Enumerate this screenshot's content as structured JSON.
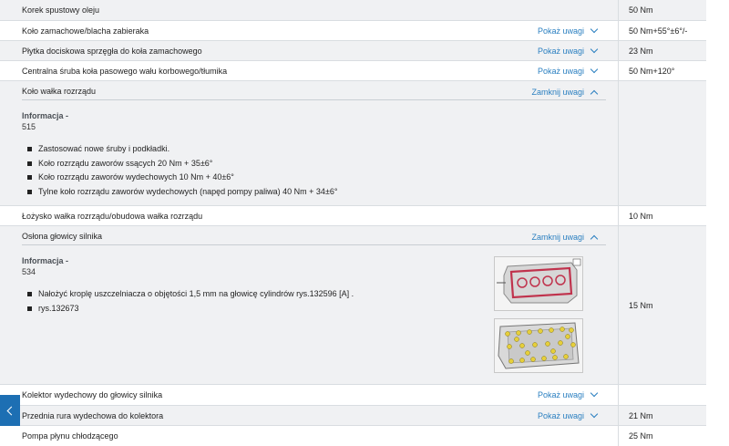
{
  "rows": [
    {
      "name": "Korek spustowy oleju",
      "value": "50 Nm",
      "toggle": ""
    },
    {
      "name": "Koło zamachowe/blacha zabieraka",
      "value": "50 Nm+55°±6°/-",
      "toggle": "Pokaż uwagi"
    },
    {
      "name": "Płytka dociskowa sprzęgła do koła zamachowego",
      "value": "23 Nm",
      "toggle": "Pokaż uwagi"
    },
    {
      "name": "Centralna śruba koła pasowego wału korbowego/tłumika",
      "value": "50 Nm+120°",
      "toggle": "Pokaż uwagi"
    },
    {
      "name": "Koło wałka rozrządu",
      "value": "",
      "toggle": "Zamknij uwagi",
      "info_title": "Informacja -",
      "info_num": "515",
      "bullets": [
        "Zastosować nowe śruby i podkładki.",
        "Koło rozrządu zaworów ssących 20 Nm + 35±6°",
        "Koło rozrządu zaworów wydechowych 10 Nm + 40±6°",
        "Tylne koło rozrządu zaworów wydechowych (napęd pompy paliwa) 40 Nm + 34±6°"
      ]
    },
    {
      "name": "Łożysko wałka rozrządu/obudowa wałka rozrządu",
      "value": "10 Nm",
      "toggle": ""
    },
    {
      "name": "Osłona głowicy silnika",
      "value": "15 Nm",
      "toggle": "Zamknij uwagi",
      "info_title": "Informacja -",
      "info_num": "534",
      "bullets": [
        "Nałożyć kroplę uszczelniacza o objętości 1,5 mm na głowicę cylindrów rys.132596 [A] .",
        "rys.132673"
      ]
    },
    {
      "name": "Kolektor wydechowy do głowicy silnika",
      "value": "",
      "toggle": "Pokaż uwagi"
    },
    {
      "name": "Przednia rura wydechowa do kolektora",
      "value": "21 Nm",
      "toggle": "Pokaż uwagi"
    },
    {
      "name": "Pompa płynu chłodzącego",
      "value": "25 Nm",
      "toggle": ""
    }
  ],
  "colors": {
    "accent": "#2a7fc0",
    "nav": "#1d6fb3"
  }
}
